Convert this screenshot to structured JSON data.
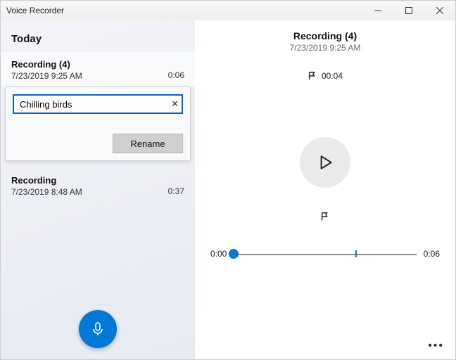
{
  "window": {
    "title": "Voice Recorder"
  },
  "colors": {
    "accent": "#0078d7"
  },
  "sidebar": {
    "section_label": "Today",
    "items": [
      {
        "title": "Recording (4)",
        "time": "7/23/2019 9:25 AM",
        "duration": "0:06"
      },
      {
        "title": "Recording",
        "time": "7/23/2019 8:48 AM",
        "duration": "0:37"
      }
    ],
    "rename": {
      "value": "Chilling birds",
      "button_label": "Rename"
    }
  },
  "player": {
    "title": "Recording (4)",
    "subtitle": "7/23/2019 9:25 AM",
    "marker_time": "00:04",
    "position_label": "0:00",
    "duration_label": "0:06",
    "tick_percent": 67,
    "thumb_percent": 0
  }
}
